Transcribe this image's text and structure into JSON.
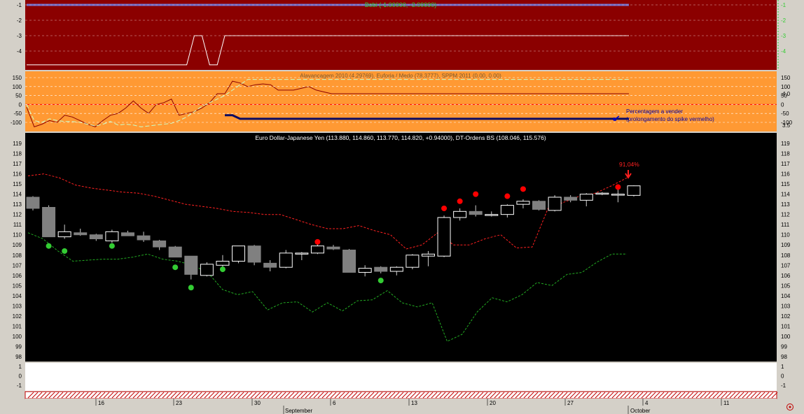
{
  "colors": {
    "panel1_bg": "#8b0000",
    "panel2_bg": "#ff9933",
    "panel3_bg": "#000000",
    "panel4_bg": "#ffffff",
    "up_candle": "#ffffff",
    "down_candle": "#808080",
    "upper_band": "#ff2020",
    "lower_band": "#22aa22",
    "sell_dot": "#ff0000",
    "buy_dot": "#33cc33",
    "axis_green": "#33cc33",
    "bobi_line": "#7070d0"
  },
  "panels": {
    "bobi": {
      "label": "Bobi (-1.00000, -3.00000)",
      "y_ticks": [
        "-1",
        "-2",
        "-3",
        "-4"
      ]
    },
    "alavancagem": {
      "label": "Alavancagem 2010 (4.29769), Euforia / Medo (78.3777), SPPM 2011 (0.00, 0.00)",
      "y_ticks": [
        "150",
        "100",
        "50",
        "0",
        "-50",
        "-100"
      ],
      "right_ticks": [
        "4.0",
        "3.5"
      ],
      "annotation_line1": "Percentagem a vender",
      "annotation_line2": "(prolongamento do spike vermelho)"
    },
    "price": {
      "label": "Euro Dollar-Japanese Yen (113.880, 114.860, 113.770, 114.820, +0.94000), DT-Ordens BS (108.046, 115.576)",
      "percent_label": "91,04%",
      "y_ticks": [
        "119",
        "118",
        "117",
        "116",
        "115",
        "114",
        "113",
        "112",
        "111",
        "110",
        "109",
        "108",
        "107",
        "106",
        "105",
        "104",
        "103",
        "102",
        "101",
        "100",
        "99",
        "98"
      ]
    },
    "lower": {
      "y_ticks": [
        "1",
        "0",
        "-1"
      ]
    }
  },
  "x_axis": {
    "day_labels": [
      "16",
      "23",
      "30",
      "6",
      "13",
      "20",
      "27",
      "4",
      "11"
    ],
    "month_labels": [
      "September",
      "October"
    ]
  },
  "chart_data": [
    {
      "type": "line",
      "title": "Bobi (-1.00000, -3.00000)",
      "ylim": [
        -4.9,
        -0.6
      ],
      "series": [
        {
          "name": "Bobi",
          "values": [
            -1,
            -1,
            -1,
            -1,
            -1,
            -1,
            -1,
            -1,
            -1,
            -1,
            -1,
            -1,
            -1,
            -1,
            -1,
            -1,
            -1,
            -1,
            -1,
            -1,
            -1,
            -1,
            -1,
            -1,
            -1,
            -1,
            -1,
            -1,
            -1,
            -1,
            -1,
            -1,
            -1,
            -1,
            -1,
            -1,
            -1,
            -1,
            -1,
            -1,
            -1,
            -1,
            -1,
            -1,
            -1,
            -1,
            -1,
            -1,
            -1,
            -1,
            -1,
            -1,
            -1,
            -1,
            -1,
            -1,
            -1,
            -1,
            -1,
            -1,
            -1,
            -1,
            -1,
            -1,
            -1,
            -1,
            -1,
            -1,
            -1,
            -1,
            -1,
            -1,
            -1,
            -1,
            -1,
            -1,
            -1,
            -1,
            -1,
            -1
          ]
        },
        {
          "values": [
            -4.9,
            -4.9,
            -4.9,
            -4.9,
            -4.9,
            -4.9,
            -4.9,
            -4.9,
            -4.9,
            -4.9,
            -4.9,
            -4.9,
            -4.9,
            -4.9,
            -4.9,
            -4.9,
            -4.9,
            -4.9,
            -4.9,
            -4.9,
            -4.9,
            -4.9,
            -3,
            -3,
            -4.9,
            -4.9,
            -3,
            -3,
            -3,
            -3,
            -3,
            -3,
            -3,
            -3,
            -3,
            -3,
            -3,
            -3,
            -3,
            -3,
            -3,
            -3,
            -3,
            -3,
            -3,
            -3,
            -3,
            -3,
            -3,
            -3,
            -3,
            -3,
            -3,
            -3,
            -3,
            -3,
            -3,
            -3,
            -3,
            -3,
            -3,
            -3,
            -3,
            -3,
            -3,
            -3,
            -3,
            -3,
            -3,
            -3,
            -3,
            -3,
            -3,
            -3,
            -3,
            -3,
            -3,
            -3,
            -3,
            -3
          ]
        }
      ]
    },
    {
      "type": "line",
      "title": "Alavancagem 2010 (4.29769), Euforia / Medo (78.3777), SPPM 2011 (0.00, 0.00)",
      "ylim": [
        -150,
        160
      ],
      "series": [
        {
          "name": "Alavancagem 2010",
          "values": [
            -15,
            -125,
            -110,
            -90,
            -100,
            -60,
            -70,
            -90,
            -110,
            -125,
            -90,
            -60,
            -50,
            -20,
            20,
            -20,
            -50,
            0,
            10,
            30,
            -60,
            -50,
            -40,
            -20,
            10,
            60,
            60,
            130,
            120,
            100,
            110,
            115,
            110,
            80,
            80,
            80,
            90,
            100,
            80,
            70,
            60,
            60,
            60,
            60,
            60,
            60,
            60,
            60,
            60,
            60,
            60,
            60,
            60,
            60,
            60,
            60,
            60,
            60,
            60,
            60,
            60,
            60,
            60,
            60,
            60,
            60,
            60,
            60,
            60,
            60,
            60,
            60,
            60,
            60,
            60,
            60,
            60,
            60,
            60,
            60
          ]
        },
        {
          "name": "Euforia / Medo",
          "values": [
            0,
            -90,
            -100,
            -80,
            -90,
            -95,
            -95,
            -100,
            -110,
            -120,
            -110,
            -95,
            -115,
            -110,
            -115,
            -125,
            -120,
            -115,
            -110,
            -105,
            -90,
            -70,
            -40,
            -10,
            10,
            30,
            50,
            80,
            110,
            140,
            140,
            140,
            140,
            140,
            140,
            140,
            140,
            140,
            140,
            140,
            140,
            140,
            140,
            140,
            140,
            140,
            140,
            140,
            140,
            140,
            140,
            140,
            140,
            140,
            140,
            140,
            140,
            140,
            140,
            140,
            140,
            140,
            140,
            140,
            140,
            140,
            140,
            140,
            140,
            140,
            140,
            140,
            140,
            140,
            140,
            140,
            140,
            140,
            140,
            140
          ]
        },
        {
          "name": "SPPM 2011",
          "values": [
            0,
            0,
            0,
            0,
            0,
            0,
            0,
            0,
            0,
            0,
            0,
            0,
            0,
            0,
            0,
            0,
            0,
            0,
            0,
            0,
            0,
            0,
            0,
            0,
            0,
            0,
            -60,
            -60,
            -80,
            -80,
            -80,
            -80,
            -80,
            -80,
            -80,
            -80,
            -80,
            -80,
            -80,
            -80,
            -80,
            -80,
            -80,
            -80,
            -80,
            -80,
            -80,
            -80,
            -80,
            -80,
            -80,
            -80,
            -80,
            -80,
            -80,
            -80,
            -80,
            -80,
            -80,
            -80,
            -80,
            -80,
            -80,
            -80,
            -80,
            -80,
            -80,
            -80,
            -80,
            -80,
            -80,
            -80,
            -80,
            -80,
            -80,
            -80,
            -80,
            -80,
            -80,
            -80
          ]
        }
      ]
    },
    {
      "type": "candlestick",
      "title": "Euro Dollar-Japanese Yen (113.880, 114.860, 113.770, 114.820, +0.94000), DT-Ordens BS (108.046, 115.576)",
      "ylim": [
        98,
        119.5
      ],
      "candles": [
        {
          "o": 113.7,
          "h": 113.8,
          "l": 112.4,
          "c": 112.6
        },
        {
          "o": 112.7,
          "h": 112.9,
          "l": 109.8,
          "c": 109.8
        },
        {
          "o": 109.8,
          "h": 111.0,
          "l": 109.6,
          "c": 110.3
        },
        {
          "o": 110.2,
          "h": 110.6,
          "l": 109.9,
          "c": 110.0
        },
        {
          "o": 110.0,
          "h": 110.1,
          "l": 109.4,
          "c": 109.6
        },
        {
          "o": 109.4,
          "h": 110.5,
          "l": 109.2,
          "c": 110.3
        },
        {
          "o": 110.2,
          "h": 110.4,
          "l": 109.9,
          "c": 109.9
        },
        {
          "o": 109.9,
          "h": 110.3,
          "l": 109.3,
          "c": 109.5
        },
        {
          "o": 109.4,
          "h": 109.5,
          "l": 108.5,
          "c": 108.8
        },
        {
          "o": 108.8,
          "h": 108.9,
          "l": 107.8,
          "c": 107.8
        },
        {
          "o": 107.9,
          "h": 107.9,
          "l": 105.6,
          "c": 106.1
        },
        {
          "o": 106.0,
          "h": 107.3,
          "l": 105.9,
          "c": 107.1
        },
        {
          "o": 107.0,
          "h": 108.0,
          "l": 106.8,
          "c": 107.4
        },
        {
          "o": 107.4,
          "h": 108.9,
          "l": 107.2,
          "c": 108.9
        },
        {
          "o": 108.9,
          "h": 109.0,
          "l": 107.0,
          "c": 107.3
        },
        {
          "o": 107.2,
          "h": 107.5,
          "l": 106.4,
          "c": 106.8
        },
        {
          "o": 106.8,
          "h": 108.5,
          "l": 106.7,
          "c": 108.2
        },
        {
          "o": 108.1,
          "h": 108.3,
          "l": 107.5,
          "c": 108.2
        },
        {
          "o": 108.2,
          "h": 109.5,
          "l": 108.1,
          "c": 108.9
        },
        {
          "o": 108.8,
          "h": 109.0,
          "l": 108.5,
          "c": 108.6
        },
        {
          "o": 108.5,
          "h": 108.6,
          "l": 106.3,
          "c": 106.3
        },
        {
          "o": 106.3,
          "h": 107.0,
          "l": 105.9,
          "c": 106.7
        },
        {
          "o": 106.8,
          "h": 106.9,
          "l": 106.2,
          "c": 106.4
        },
        {
          "o": 106.4,
          "h": 106.9,
          "l": 106.0,
          "c": 106.8
        },
        {
          "o": 106.8,
          "h": 108.1,
          "l": 106.6,
          "c": 108.0
        },
        {
          "o": 107.9,
          "h": 108.4,
          "l": 106.9,
          "c": 108.1
        },
        {
          "o": 107.9,
          "h": 111.9,
          "l": 107.8,
          "c": 111.7
        },
        {
          "o": 111.7,
          "h": 112.6,
          "l": 111.4,
          "c": 112.3
        },
        {
          "o": 112.3,
          "h": 112.9,
          "l": 111.8,
          "c": 112.0
        },
        {
          "o": 112.0,
          "h": 112.3,
          "l": 111.8,
          "c": 112.0
        },
        {
          "o": 112.0,
          "h": 113.0,
          "l": 111.7,
          "c": 112.9
        },
        {
          "o": 113.0,
          "h": 113.5,
          "l": 112.6,
          "c": 113.3
        },
        {
          "o": 113.3,
          "h": 113.4,
          "l": 112.4,
          "c": 112.5
        },
        {
          "o": 112.4,
          "h": 113.9,
          "l": 112.3,
          "c": 113.7
        },
        {
          "o": 113.7,
          "h": 113.9,
          "l": 113.2,
          "c": 113.4
        },
        {
          "o": 113.4,
          "h": 114.1,
          "l": 112.8,
          "c": 114.0
        },
        {
          "o": 114.0,
          "h": 114.2,
          "l": 113.9,
          "c": 114.1
        },
        {
          "o": 114.0,
          "h": 114.6,
          "l": 113.2,
          "c": 114.0
        },
        {
          "o": 113.88,
          "h": 114.86,
          "l": 113.77,
          "c": 114.82
        }
      ],
      "series": [
        {
          "values": [
            115.8,
            116.0,
            115.6,
            114.9,
            114.6,
            114.4,
            114.2,
            114.1,
            113.8,
            113.4,
            113.0,
            112.8,
            112.6,
            112.3,
            112.2,
            112.0,
            112.0,
            111.5,
            111.0,
            110.6,
            110.6,
            110.9,
            110.4,
            110.0,
            108.6,
            109.0,
            110.2,
            109.0,
            109.0,
            109.6,
            110.0,
            108.7,
            108.8,
            112.6,
            113.2,
            113.8,
            114.1,
            114.8,
            115.6
          ]
        },
        {
          "values": [
            110.2,
            109.6,
            108.4,
            107.4,
            107.5,
            107.6,
            107.6,
            107.8,
            108.1,
            107.6,
            107.4,
            107.0,
            106.3,
            104.6,
            104.1,
            104.4,
            102.6,
            103.3,
            103.4,
            102.4,
            103.3,
            102.5,
            103.5,
            103.6,
            104.5,
            103.3,
            102.9,
            103.3,
            99.5,
            100.2,
            102.4,
            103.8,
            103.4,
            104.1,
            105.3,
            105.0,
            106.1,
            106.3,
            107.3,
            108.1,
            108.1
          ]
        }
      ]
    }
  ]
}
